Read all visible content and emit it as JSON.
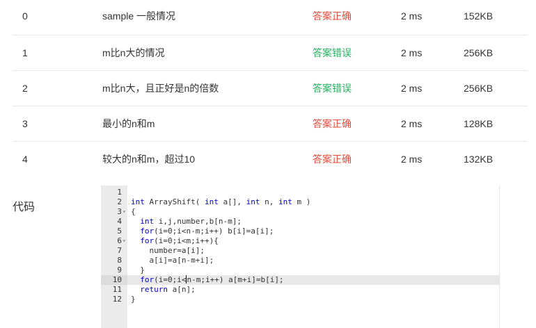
{
  "results": [
    {
      "id": "0",
      "desc": "sample 一般情况",
      "status": "答案正确",
      "time": "2 ms",
      "memory": "152KB",
      "ok": true
    },
    {
      "id": "1",
      "desc": "m比n大的情况",
      "status": "答案错误",
      "time": "2 ms",
      "memory": "256KB",
      "ok": false
    },
    {
      "id": "2",
      "desc": "m比n大，且正好是n的倍数",
      "status": "答案错误",
      "time": "2 ms",
      "memory": "256KB",
      "ok": false
    },
    {
      "id": "3",
      "desc": "最小的n和m",
      "status": "答案正确",
      "time": "2 ms",
      "memory": "128KB",
      "ok": true
    },
    {
      "id": "4",
      "desc": "较大的n和m，超过10",
      "status": "答案正确",
      "time": "2 ms",
      "memory": "132KB",
      "ok": true
    }
  ],
  "code_section": {
    "label": "代码",
    "active_line": 10,
    "lines": [
      {
        "n": "1",
        "text": ""
      },
      {
        "n": "2",
        "text": "int ArrayShift( int a[], int n, int m )"
      },
      {
        "n": "3",
        "text": "{",
        "fold": true
      },
      {
        "n": "4",
        "text": "  int i,j,number,b[n-m];"
      },
      {
        "n": "5",
        "text": "  for(i=0;i<n-m;i++) b[i]=a[i];"
      },
      {
        "n": "6",
        "text": "  for(i=0;i<m;i++){",
        "fold": true
      },
      {
        "n": "7",
        "text": "    number=a[i];"
      },
      {
        "n": "8",
        "text": "    a[i]=a[n-m+i];"
      },
      {
        "n": "9",
        "text": "  }"
      },
      {
        "n": "10",
        "text": "  for(i=0;i<n-m;i++) a[m+i]=b[i];"
      },
      {
        "n": "11",
        "text": "  return a[n];"
      },
      {
        "n": "12",
        "text": "}"
      }
    ]
  },
  "colors": {
    "pass": "#e74c3c",
    "fail": "#27ae60",
    "keyword": "#0000cc"
  },
  "icons": {
    "fold": "fold-triangle-icon"
  }
}
